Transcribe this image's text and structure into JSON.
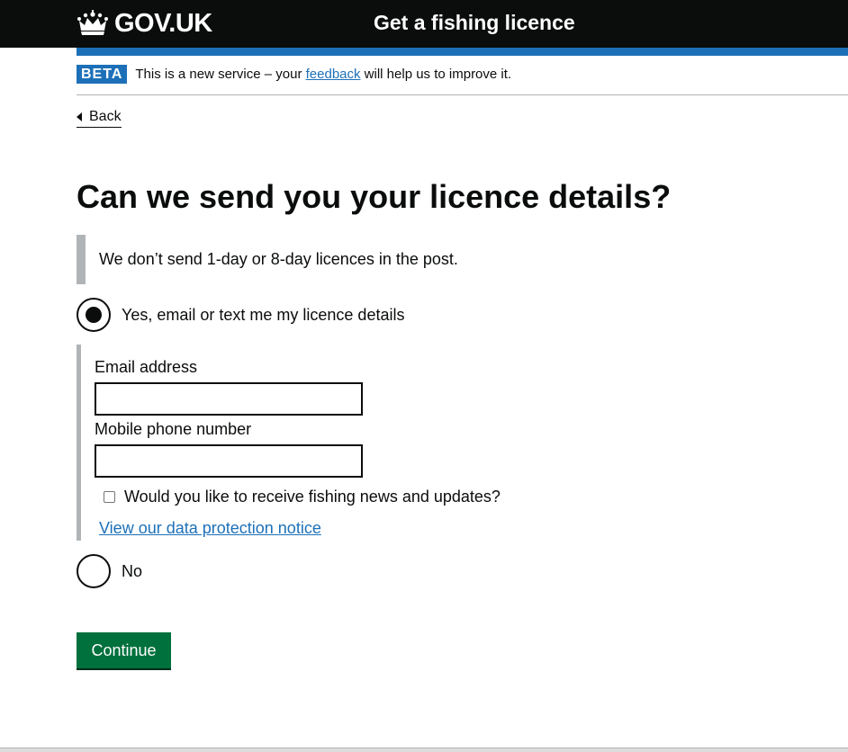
{
  "header": {
    "logo_text": "GOV.UK",
    "service_name": "Get a fishing licence",
    "colors": {
      "background": "#0b0c0c",
      "accent_bar": "#1d70b8"
    }
  },
  "phase_banner": {
    "tag": "BETA",
    "text_before": "This is a new service – your ",
    "link_text": "feedback",
    "text_after": " will help us to improve it."
  },
  "back_link": {
    "label": "Back"
  },
  "page_title": "Can we send you your licence details?",
  "inset_text": "We don’t send 1-day or 8-day licences in the post.",
  "options": {
    "yes": {
      "label": "Yes, email or text me my licence details",
      "checked": true
    },
    "no": {
      "label": "No",
      "checked": false
    }
  },
  "conditional": {
    "email_label": "Email address",
    "email_value": "",
    "mobile_label": "Mobile phone number",
    "mobile_value": "",
    "newsletter_label": "Would you like to receive fishing news and updates?",
    "newsletter_checked": false,
    "data_protection_link": "View our data protection notice"
  },
  "continue_button": {
    "label": "Continue",
    "color": "#00703c"
  },
  "icons": {
    "logo": "crown-icon",
    "back": "back-arrow-icon"
  }
}
